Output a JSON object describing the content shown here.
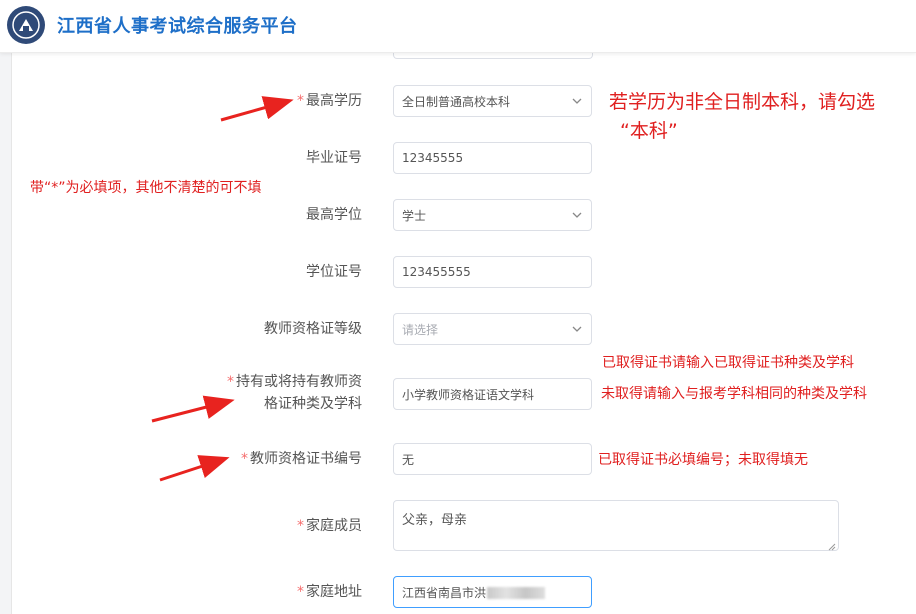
{
  "header": {
    "title": "江西省人事考试综合服务平台",
    "logo_icon": "emblem-icon"
  },
  "form": {
    "fields": [
      {
        "key": "education",
        "label": "最高学历",
        "required": true,
        "type": "select",
        "value": "全日制普通高校本科"
      },
      {
        "key": "diploma_no",
        "label": "毕业证号",
        "required": false,
        "type": "input",
        "value": "12345555"
      },
      {
        "key": "degree",
        "label": "最高学位",
        "required": false,
        "type": "select",
        "value": "学士"
      },
      {
        "key": "degree_no",
        "label": "学位证号",
        "required": false,
        "type": "input",
        "value": "123455555"
      },
      {
        "key": "teacher_cert_level",
        "label": "教师资格证等级",
        "required": false,
        "type": "select",
        "value": "",
        "placeholder": "请选择"
      },
      {
        "key": "teacher_cert_type",
        "label_line1": "持有或将持有教师资",
        "label_line2": "格证种类及学科",
        "required": true,
        "type": "input",
        "value": "小学教师资格证语文学科"
      },
      {
        "key": "teacher_cert_no",
        "label": "教师资格证书编号",
        "required": true,
        "type": "input",
        "value": "无"
      },
      {
        "key": "family_members",
        "label": "家庭成员",
        "required": true,
        "type": "textarea",
        "value": "父亲，母亲"
      },
      {
        "key": "home_address",
        "label": "家庭地址",
        "required": true,
        "type": "input",
        "value": "江西省南昌市洪"
      }
    ],
    "required_mark": "*"
  },
  "annotations": {
    "education_note_1": "若学历为非全日制本科，请勾选",
    "education_note_2": "“本科”",
    "required_note": "带“*”为必填项，其他不清楚的可不填",
    "cert_type_note_1": "已取得证书请输入已取得证书种类及学科",
    "cert_type_note_2": "未取得请输入与报考学科相同的种类及学科",
    "cert_no_note": "已取得证书必填编号；未取得填无",
    "arrow_color": "#e8231f"
  }
}
